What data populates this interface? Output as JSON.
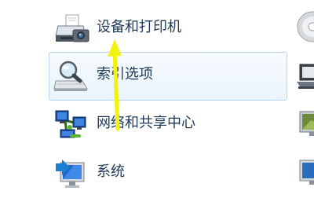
{
  "items": [
    {
      "label": "设备和打印机",
      "icon": "printer-icon"
    },
    {
      "label": "索引选项",
      "icon": "index-options-icon"
    },
    {
      "label": "网络和共享中心",
      "icon": "network-center-icon"
    },
    {
      "label": "系统",
      "icon": "system-icon"
    }
  ],
  "right_column_icons": [
    "disc-icon",
    "laptop-icon",
    "monitor-icon",
    "monitor-icon"
  ],
  "colors": {
    "label_text": "#1e395b",
    "hover_background": "#eaf4fc",
    "hover_border": "#b8d6f1",
    "annotation_arrow": "#f2f20a"
  }
}
